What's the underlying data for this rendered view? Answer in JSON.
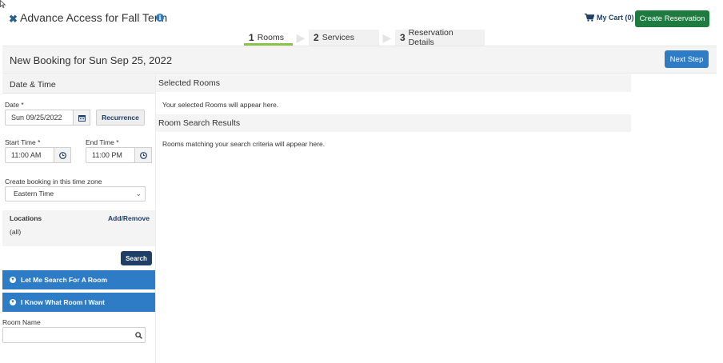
{
  "header": {
    "close_icon": "close-icon",
    "title": "Advance Access for Fall Term",
    "info_icon": "info-icon",
    "cart_label": "My Cart (0)",
    "create_button": "Create Reservation"
  },
  "steps": [
    {
      "num": "1",
      "label": "Rooms",
      "active": true
    },
    {
      "num": "2",
      "label": "Services",
      "active": false
    },
    {
      "num": "3",
      "label": "Reservation Details",
      "active": false
    }
  ],
  "booking": {
    "title": "New Booking for Sun Sep 25, 2022",
    "next_button": "Next Step"
  },
  "left": {
    "section_title": "Date & Time",
    "date_label": "Date *",
    "date_value": "Sun 09/25/2022",
    "recurrence_button": "Recurrence",
    "start_label": "Start Time *",
    "start_value": "11:00 AM",
    "end_label": "End Time *",
    "end_value": "11:00 PM",
    "timezone_label": "Create booking in this time zone",
    "timezone_value": "Eastern Time",
    "locations_label": "Locations",
    "add_remove": "Add/Remove",
    "locations_value": "(all)",
    "search_button": "Search",
    "accordion_search": "Let Me Search For A Room",
    "accordion_know": "I Know What Room I Want",
    "room_name_label": "Room Name",
    "room_name_value": ""
  },
  "right": {
    "selected_title": "Selected Rooms",
    "selected_msg": "Your selected Rooms will appear here.",
    "results_title": "Room Search Results",
    "results_msg": "Rooms matching your search criteria will appear here."
  },
  "colors": {
    "primary_blue": "#2f7cc6",
    "dark_navy": "#1f3f66",
    "green": "#1e7b3f",
    "step_underline": "#8bc34a"
  }
}
